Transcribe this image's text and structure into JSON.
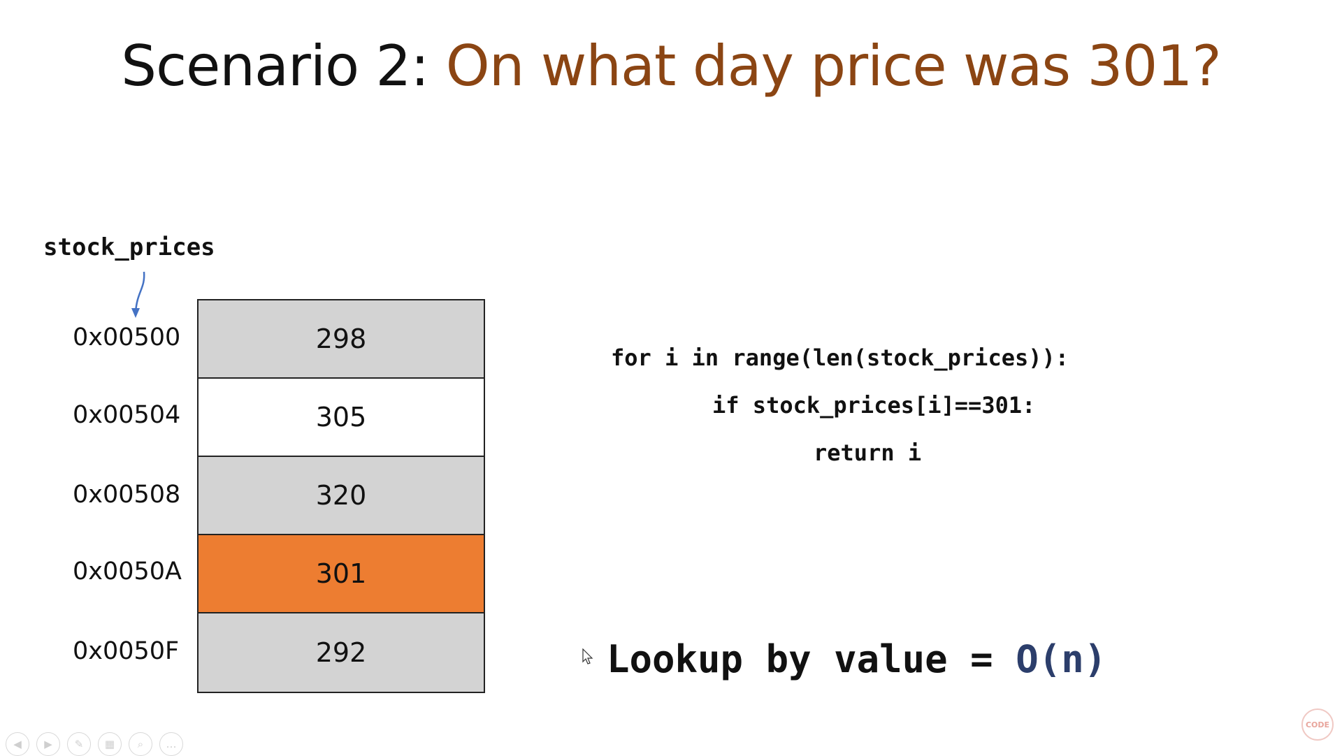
{
  "slide": {
    "title_prefix": "Scenario 2:",
    "title_question": "On what day price was 301?",
    "variable_name": "stock_prices",
    "memory": [
      {
        "address": "0x00500",
        "value": "298",
        "color": "#d3d3d3"
      },
      {
        "address": "0x00504",
        "value": "305",
        "color": "#ffffff"
      },
      {
        "address": "0x00508",
        "value": "320",
        "color": "#d3d3d3"
      },
      {
        "address": "0x0050A",
        "value": "301",
        "color": "#ed7d31"
      },
      {
        "address": "0x0050F",
        "value": "292",
        "color": "#d3d3d3"
      }
    ],
    "code": [
      "for i in range(len(stock_prices)):",
      "if stock_prices[i]==301:",
      "return i"
    ],
    "lookup_label": "Lookup by value =",
    "lookup_complexity": "O(n)"
  },
  "controls": [
    {
      "icon": "previous-icon",
      "glyph": "◀"
    },
    {
      "icon": "next-icon",
      "glyph": "▶"
    },
    {
      "icon": "pen-icon",
      "glyph": "✎"
    },
    {
      "icon": "slides-icon",
      "glyph": "▦"
    },
    {
      "icon": "zoom-icon",
      "glyph": "⌕"
    },
    {
      "icon": "more-icon",
      "glyph": "…"
    }
  ],
  "logo": {
    "text": "CODE"
  },
  "colors": {
    "title_accent": "#8B4513",
    "highlight": "#ed7d31",
    "complexity": "#2c3e6b"
  }
}
